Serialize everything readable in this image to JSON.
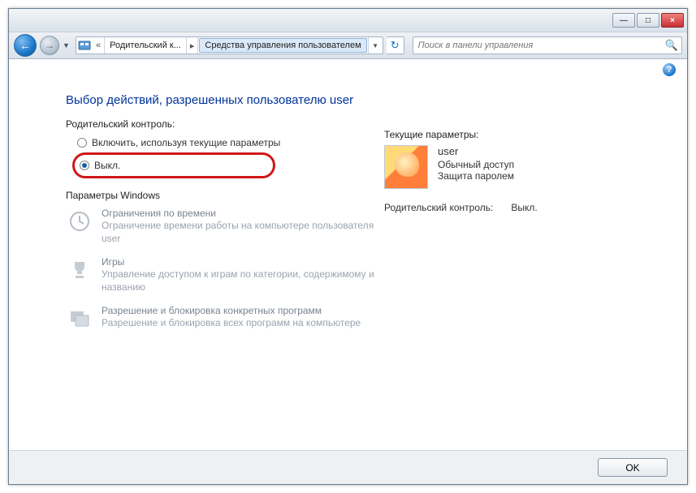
{
  "titlebar": {
    "minimize": "—",
    "maximize": "□",
    "close": "×"
  },
  "nav": {
    "breadcrumb_prefix": "«",
    "breadcrumb_1": "Родительский к...",
    "breadcrumb_2": "Средства управления пользователем",
    "search_placeholder": "Поиск в панели управления"
  },
  "page": {
    "title": "Выбор действий, разрешенных пользователю user",
    "parental_label": "Родительский контроль:",
    "radio_on": "Включить, используя текущие параметры",
    "radio_off": "Выкл.",
    "windows_params": "Параметры Windows",
    "time": {
      "title": "Ограничения по времени",
      "desc": "Ограничение времени работы на компьютере пользователя user"
    },
    "games": {
      "title": "Игры",
      "desc": "Управление доступом к играм по категории, содержимому и названию"
    },
    "programs": {
      "title": "Разрешение и блокировка конкретных программ",
      "desc": "Разрешение и блокировка всех программ на компьютере"
    }
  },
  "right": {
    "current_label": "Текущие параметры:",
    "user_name": "user",
    "user_type": "Обычный доступ",
    "user_pwd": "Защита паролем",
    "pc_label": "Родительский контроль:",
    "pc_value": "Выкл."
  },
  "footer": {
    "ok": "OK"
  }
}
